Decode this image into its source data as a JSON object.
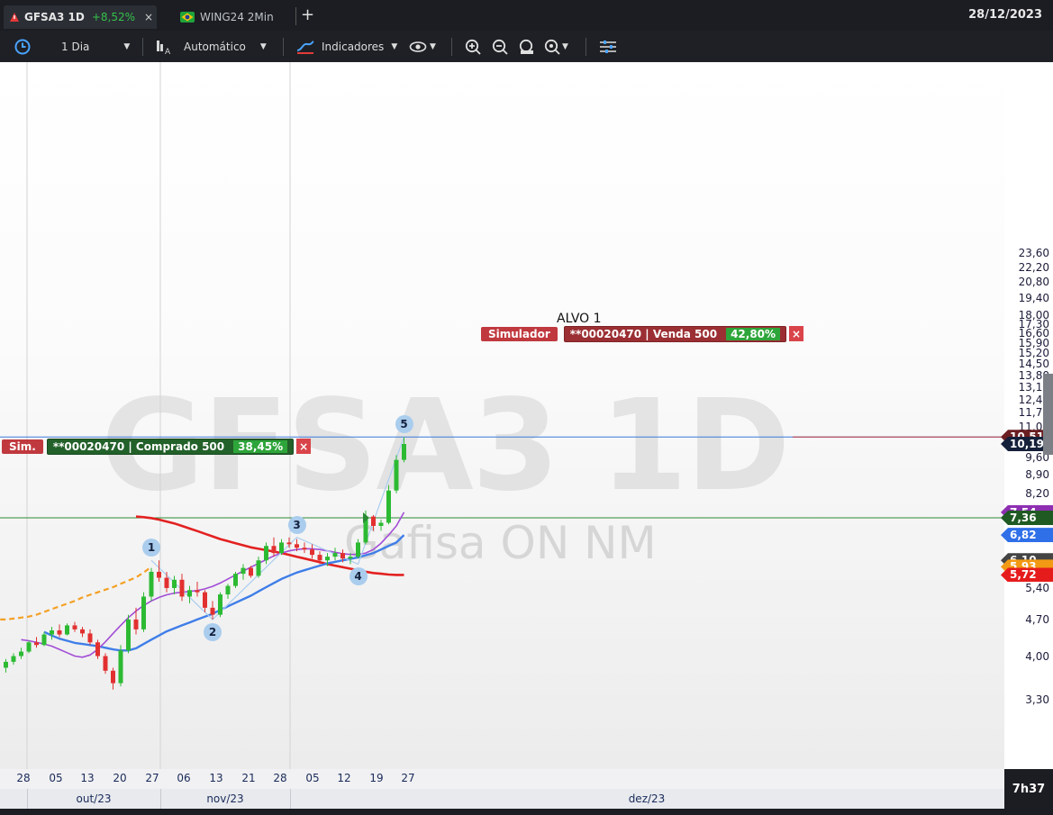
{
  "tabs": [
    {
      "symbol": "GFSA3 1D",
      "change": "+8,52%",
      "close": "×"
    },
    {
      "symbol": "WING24 2Min"
    }
  ],
  "top_date": "28/12/2023",
  "toolbar": {
    "period": "1 Dia",
    "scale": "Automático",
    "indicators": "Indicadores"
  },
  "watermark": {
    "symbol": "GFSA3 1D",
    "name": "Gafisa ON NM"
  },
  "annotation": "ALVO 1",
  "orders": {
    "sell": {
      "tag": "Simulador",
      "text": "**00020470 | Venda 500",
      "pct": "42,80%",
      "close": "×"
    },
    "buy": {
      "tag": "Sim.",
      "text": "**00020470 | Comprado 500",
      "pct": "38,45%",
      "close": "×"
    }
  },
  "price_tags": [
    {
      "label": "10,51",
      "value": 10.51,
      "color": "#6b1f22"
    },
    {
      "label": "10,19",
      "value": 10.19,
      "color": "#15213a"
    },
    {
      "label": "7,54",
      "value": 7.54,
      "color": "#8e2fb2"
    },
    {
      "label": "7,36",
      "value": 7.36,
      "color": "#1e5a22"
    },
    {
      "label": "6,82",
      "value": 6.82,
      "color": "#2f6fe8"
    },
    {
      "label": "6,10",
      "value": 6.1,
      "color": "#444444"
    },
    {
      "label": "5,93",
      "value": 5.93,
      "color": "#f29a14"
    },
    {
      "label": "5,72",
      "value": 5.72,
      "color": "#e61c1c"
    }
  ],
  "clock": "7h37",
  "colors": {
    "up": "#2dba33",
    "down": "#e23030",
    "ma_fast": "#a24dd6",
    "ma_mid": "#3f7ee8",
    "ma_slow": "#e32121",
    "ma_long": "#f4a024"
  },
  "chart_data": {
    "type": "candlestick",
    "title": "GFSA3 1D",
    "ylim": [
      3.0,
      24.5
    ],
    "y_scale": "log",
    "y_ticks": [
      {
        "label": "23,60",
        "value": 23.6
      },
      {
        "label": "22,20",
        "value": 22.2
      },
      {
        "label": "20,80",
        "value": 20.8
      },
      {
        "label": "19,40",
        "value": 19.4
      },
      {
        "label": "18,00",
        "value": 18.0
      },
      {
        "label": "17,30",
        "value": 17.3
      },
      {
        "label": "16,60",
        "value": 16.6
      },
      {
        "label": "15,90",
        "value": 15.9
      },
      {
        "label": "15,20",
        "value": 15.2
      },
      {
        "label": "14,50",
        "value": 14.5
      },
      {
        "label": "13,80",
        "value": 13.8
      },
      {
        "label": "13,10",
        "value": 13.1
      },
      {
        "label": "12,40",
        "value": 12.4
      },
      {
        "label": "11,70",
        "value": 11.7
      },
      {
        "label": "11,00",
        "value": 11.0
      },
      {
        "label": "9,60",
        "value": 9.6
      },
      {
        "label": "8,90",
        "value": 8.9
      },
      {
        "label": "8,20",
        "value": 8.2
      },
      {
        "label": "5,40",
        "value": 5.4
      },
      {
        "label": "4,70",
        "value": 4.7
      },
      {
        "label": "4,00",
        "value": 4.0
      },
      {
        "label": "3,30",
        "value": 3.3
      }
    ],
    "x_ticks": [
      {
        "label": "28",
        "date": "2023-09-28"
      },
      {
        "label": "05",
        "date": "2023-10-05"
      },
      {
        "label": "13",
        "date": "2023-10-13"
      },
      {
        "label": "20",
        "date": "2023-10-20"
      },
      {
        "label": "27",
        "date": "2023-10-27"
      },
      {
        "label": "06",
        "date": "2023-11-06"
      },
      {
        "label": "13",
        "date": "2023-11-13"
      },
      {
        "label": "21",
        "date": "2023-11-21"
      },
      {
        "label": "28",
        "date": "2023-11-28"
      },
      {
        "label": "05",
        "date": "2023-12-05"
      },
      {
        "label": "12",
        "date": "2023-12-12"
      },
      {
        "label": "19",
        "date": "2023-12-19"
      },
      {
        "label": "27",
        "date": "2023-12-27"
      }
    ],
    "months": [
      "out/23",
      "nov/23",
      "dez/23"
    ],
    "candles": [
      [
        3.8,
        3.95,
        3.72,
        3.9
      ],
      [
        3.9,
        4.05,
        3.85,
        4.0
      ],
      [
        4.0,
        4.15,
        3.95,
        4.08
      ],
      [
        4.08,
        4.28,
        4.05,
        4.25
      ],
      [
        4.25,
        4.35,
        4.15,
        4.2
      ],
      [
        4.2,
        4.45,
        4.18,
        4.4
      ],
      [
        4.4,
        4.55,
        4.3,
        4.48
      ],
      [
        4.48,
        4.6,
        4.35,
        4.4
      ],
      [
        4.4,
        4.62,
        4.38,
        4.58
      ],
      [
        4.58,
        4.65,
        4.45,
        4.5
      ],
      [
        4.5,
        4.55,
        4.35,
        4.42
      ],
      [
        4.42,
        4.5,
        4.2,
        4.25
      ],
      [
        4.25,
        4.3,
        3.95,
        4.0
      ],
      [
        4.0,
        4.05,
        3.7,
        3.75
      ],
      [
        3.75,
        3.8,
        3.45,
        3.55
      ],
      [
        3.55,
        4.2,
        3.5,
        4.1
      ],
      [
        4.1,
        4.8,
        4.05,
        4.7
      ],
      [
        4.7,
        4.95,
        4.4,
        4.5
      ],
      [
        4.5,
        5.3,
        4.45,
        5.2
      ],
      [
        5.2,
        5.9,
        5.1,
        5.8
      ],
      [
        5.8,
        6.1,
        5.55,
        5.65
      ],
      [
        5.65,
        5.8,
        5.3,
        5.4
      ],
      [
        5.4,
        5.7,
        5.25,
        5.6
      ],
      [
        5.6,
        5.75,
        5.1,
        5.2
      ],
      [
        5.2,
        5.45,
        5.05,
        5.35
      ],
      [
        5.35,
        5.55,
        5.2,
        5.3
      ],
      [
        5.3,
        5.35,
        4.85,
        4.95
      ],
      [
        4.95,
        5.1,
        4.7,
        4.8
      ],
      [
        4.8,
        5.3,
        4.75,
        5.25
      ],
      [
        5.25,
        5.5,
        5.15,
        5.45
      ],
      [
        5.45,
        5.8,
        5.4,
        5.75
      ],
      [
        5.75,
        6.0,
        5.6,
        5.9
      ],
      [
        5.9,
        5.95,
        5.65,
        5.7
      ],
      [
        5.7,
        6.2,
        5.65,
        6.1
      ],
      [
        6.1,
        6.6,
        6.0,
        6.5
      ],
      [
        6.5,
        6.75,
        6.2,
        6.3
      ],
      [
        6.3,
        6.7,
        6.25,
        6.6
      ],
      [
        6.6,
        6.75,
        6.45,
        6.55
      ],
      [
        6.55,
        6.7,
        6.35,
        6.45
      ],
      [
        6.45,
        6.6,
        6.3,
        6.4
      ],
      [
        6.4,
        6.55,
        6.15,
        6.25
      ],
      [
        6.25,
        6.35,
        6.0,
        6.1
      ],
      [
        6.1,
        6.3,
        5.95,
        6.2
      ],
      [
        6.2,
        6.45,
        6.1,
        6.3
      ],
      [
        6.3,
        6.4,
        6.05,
        6.15
      ],
      [
        6.15,
        6.3,
        6.0,
        6.2
      ],
      [
        6.2,
        6.7,
        6.15,
        6.6
      ],
      [
        6.6,
        7.6,
        6.55,
        7.4
      ],
      [
        7.4,
        7.45,
        6.95,
        7.1
      ],
      [
        7.1,
        7.3,
        6.95,
        7.2
      ],
      [
        7.2,
        8.5,
        7.15,
        8.3
      ],
      [
        8.3,
        9.7,
        8.2,
        9.5
      ],
      [
        9.5,
        10.5,
        9.4,
        10.19
      ]
    ],
    "ma_fast": [
      4.3,
      4.28,
      4.25,
      4.22,
      4.18,
      4.12,
      4.06,
      4.0,
      3.98,
      4.02,
      4.12,
      4.26,
      4.42,
      4.58,
      4.74,
      4.88,
      5.0,
      5.1,
      5.18,
      5.24,
      5.28,
      5.3,
      5.32,
      5.34,
      5.38,
      5.44,
      5.52,
      5.62,
      5.72,
      5.82,
      5.92,
      6.02,
      6.12,
      6.22,
      6.3,
      6.36,
      6.4,
      6.42,
      6.42,
      6.4,
      6.36,
      6.32,
      6.28,
      6.26,
      6.26,
      6.3,
      6.4,
      6.58,
      6.82,
      7.1,
      7.54
    ],
    "ma_mid": [
      4.45,
      4.38,
      4.32,
      4.28,
      4.24,
      4.22,
      4.2,
      4.18,
      4.15,
      4.12,
      4.1,
      4.1,
      4.14,
      4.22,
      4.3,
      4.38,
      4.46,
      4.52,
      4.58,
      4.64,
      4.7,
      4.76,
      4.82,
      4.9,
      4.98,
      5.06,
      5.14,
      5.22,
      5.32,
      5.42,
      5.52,
      5.62,
      5.7,
      5.78,
      5.84,
      5.9,
      5.96,
      6.02,
      6.06,
      6.1,
      6.14,
      6.18,
      6.24,
      6.3,
      6.4,
      6.5,
      6.6,
      6.82
    ],
    "ma_slow": [
      7.4,
      7.38,
      7.35,
      7.3,
      7.24,
      7.18,
      7.1,
      7.02,
      6.94,
      6.86,
      6.78,
      6.7,
      6.64,
      6.58,
      6.52,
      6.46,
      6.42,
      6.38,
      6.34,
      6.3,
      6.25,
      6.2,
      6.15,
      6.1,
      6.05,
      6.0,
      5.96,
      5.92,
      5.88,
      5.84,
      5.8,
      5.77,
      5.75,
      5.73,
      5.72,
      5.72
    ],
    "ma_long": [
      5.3,
      5.2,
      5.1,
      5.0,
      4.9,
      4.82,
      4.76,
      4.72,
      4.7,
      4.68,
      4.68,
      4.68,
      4.68,
      4.7,
      4.7,
      4.72,
      4.74,
      4.76,
      4.8,
      4.86,
      4.92,
      4.98,
      5.04,
      5.1,
      5.18,
      5.24,
      5.3,
      5.36,
      5.42,
      5.5,
      5.58,
      5.66,
      5.78,
      5.93
    ],
    "waves": [
      {
        "label": "1",
        "candle": 19,
        "value": 6.1
      },
      {
        "label": "2",
        "candle": 27,
        "value": 4.7
      },
      {
        "label": "3",
        "candle": 38,
        "value": 6.75
      },
      {
        "label": "4",
        "candle": 46,
        "value": 6.0
      },
      {
        "label": "5",
        "candle": 52,
        "value": 10.51
      }
    ]
  }
}
